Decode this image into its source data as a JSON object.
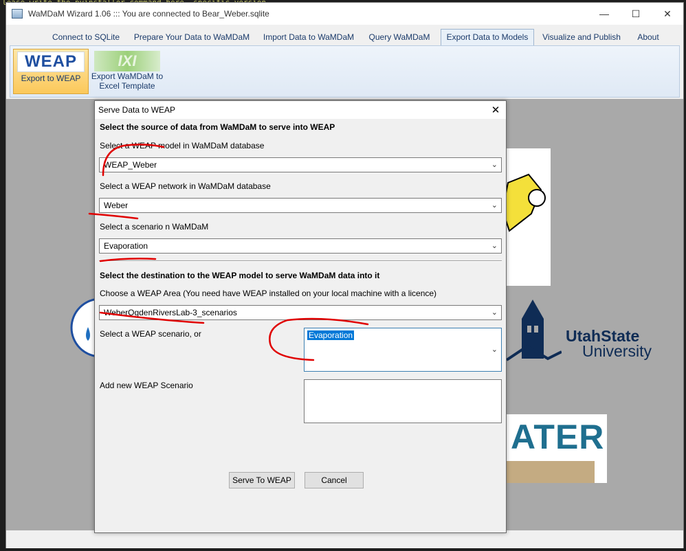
{
  "terminal": {
    "lines": [
      "lease write the pyinstaller command here, specific version"
    ]
  },
  "window": {
    "title": "WaMDaM Wizard 1.06 ::: You are connected to Bear_Weber.sqlite",
    "minimize": "—",
    "maximize": "☐",
    "close": "✕"
  },
  "menu": {
    "tabs": [
      "Connect to SQLite",
      "Prepare Your Data to WaMDaM",
      "Import Data to WaMDaM",
      "Query WaMDaM",
      "Export Data to Models",
      "Visualize and Publish",
      "About"
    ],
    "active_index": 4
  },
  "ribbon": {
    "weap_logo": "WEAP",
    "export_weap_label": "Export to WEAP",
    "excel_logo": "IXI",
    "export_excel_line1": "Export WaMDaM to",
    "export_excel_line2": "Excel Template"
  },
  "background_logos": {
    "usu_line1": "UtahState",
    "usu_line2": "University",
    "water": "ATER"
  },
  "dialog": {
    "title": "Serve Data to WEAP",
    "close": "✕",
    "source_heading": "Select the source of data from WaMDaM to serve into WEAP",
    "model_label": "Select a WEAP model in WaMDaM database",
    "model_value": "WEAP_Weber",
    "network_label": "Select a WEAP network in WaMDaM database",
    "network_value": "Weber",
    "scenario_label": "Select a scenario n WaMDaM",
    "scenario_value": "Evaporation",
    "destination_heading": "Select the destination to the WEAP model to serve WaMDaM data into it",
    "area_label": "Choose a WEAP Area (You need  have WEAP installed on your local machine with a licence)",
    "area_value": "WeberOgdenRiversLab-3_scenarios",
    "weap_scenario_label": "Select a WEAP scenario, or",
    "weap_scenario_value": "Evaporation",
    "new_scenario_label": "Add new WEAP Scenario",
    "new_scenario_value": "",
    "serve_button": "Serve To WEAP",
    "cancel_button": "Cancel"
  },
  "colors": {
    "accent": "#0078d7",
    "annotation": "#e00000",
    "workspace": "#a9a9a9"
  }
}
